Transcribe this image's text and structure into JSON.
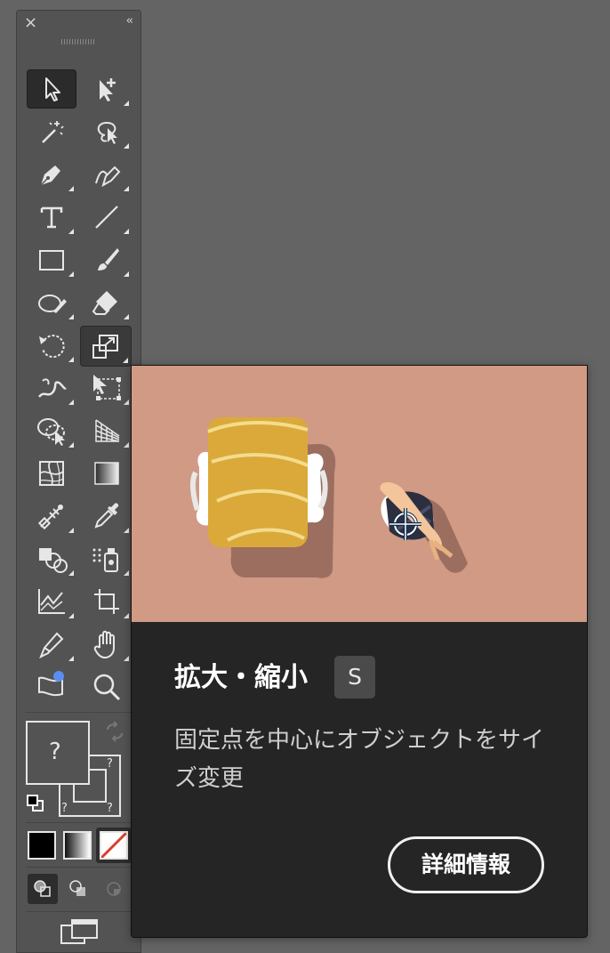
{
  "toolbar": {
    "close_glyph": "×",
    "collapse_glyph": "‹‹",
    "tools": [
      {
        "name": "selection-tool",
        "icon": "selection-arrow-icon",
        "state": "selected"
      },
      {
        "name": "direct-selection-tool",
        "icon": "direct-selection-plus-icon"
      },
      {
        "name": "magic-wand-tool",
        "icon": "magic-wand-icon"
      },
      {
        "name": "lasso-tool",
        "icon": "lasso-icon"
      },
      {
        "name": "pen-tool",
        "icon": "pen-icon"
      },
      {
        "name": "curvature-tool",
        "icon": "curvature-pen-icon"
      },
      {
        "name": "type-tool",
        "icon": "type-icon",
        "glyph": "T"
      },
      {
        "name": "line-segment-tool",
        "icon": "line-icon"
      },
      {
        "name": "rectangle-tool",
        "icon": "rectangle-icon"
      },
      {
        "name": "paintbrush-tool",
        "icon": "brush-icon"
      },
      {
        "name": "shaper-tool",
        "icon": "shaper-icon"
      },
      {
        "name": "eraser-tool",
        "icon": "eraser-icon"
      },
      {
        "name": "rotate-tool",
        "icon": "rotate-icon"
      },
      {
        "name": "scale-tool",
        "icon": "scale-icon",
        "state": "active"
      },
      {
        "name": "width-tool",
        "icon": "width-icon"
      },
      {
        "name": "free-transform-tool",
        "icon": "free-transform-icon"
      },
      {
        "name": "shape-builder-tool",
        "icon": "shape-builder-icon"
      },
      {
        "name": "perspective-grid-tool",
        "icon": "perspective-grid-icon"
      },
      {
        "name": "mesh-tool",
        "icon": "mesh-icon"
      },
      {
        "name": "gradient-tool",
        "icon": "gradient-icon"
      },
      {
        "name": "blend-tool",
        "icon": "blend-icon"
      },
      {
        "name": "eyedropper-tool",
        "icon": "eyedropper-icon"
      },
      {
        "name": "live-paint-bucket-tool",
        "icon": "live-paint-icon"
      },
      {
        "name": "symbol-sprayer-tool",
        "icon": "symbol-sprayer-icon"
      },
      {
        "name": "column-graph-tool",
        "icon": "graph-icon"
      },
      {
        "name": "artboard-tool",
        "icon": "artboard-icon"
      },
      {
        "name": "slice-tool",
        "icon": "slice-knife-icon"
      },
      {
        "name": "hand-tool",
        "icon": "hand-icon"
      },
      {
        "name": "edit-toolbar",
        "icon": "toolbar-edit-icon"
      },
      {
        "name": "zoom-tool",
        "icon": "zoom-icon"
      }
    ],
    "fill_stroke": {
      "question_mark": "?",
      "corner_mark": "?"
    },
    "color_modes": [
      "color",
      "gradient",
      "none"
    ],
    "draw_modes": [
      "draw-normal",
      "draw-behind",
      "draw-inside"
    ],
    "colors": {
      "panel": "#535353",
      "canvas": "#646464",
      "none_slash": "#d8412f"
    }
  },
  "tooltip": {
    "title": "拡大・縮小",
    "shortcut": "S",
    "description": "固定点を中心にオブジェクトをサイズ変更",
    "learn_more": "詳細情報",
    "image_bg": "#d09a85"
  }
}
